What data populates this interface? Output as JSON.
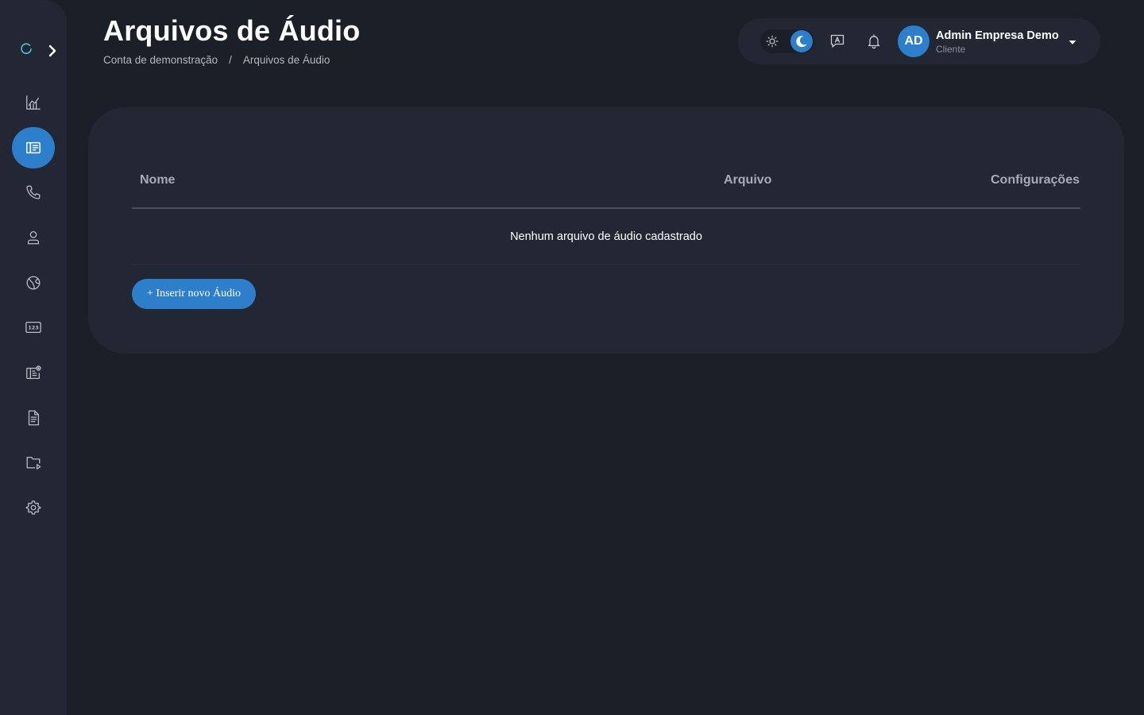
{
  "colors": {
    "background": "#1b1f27",
    "panel": "#222733",
    "accent": "#2e7fcb",
    "icon": "#b9bdc6",
    "muted_text": "#a6abb5"
  },
  "sidebar": {
    "logo_icon": "spinner-logo-icon",
    "expand_icon": "chevron-right-icon",
    "items": [
      {
        "icon": "chart-icon",
        "active": false
      },
      {
        "icon": "audio-library-icon",
        "active": true
      },
      {
        "icon": "phone-icon",
        "active": false
      },
      {
        "icon": "user-icon",
        "active": false
      },
      {
        "icon": "globe-icon",
        "active": false
      },
      {
        "icon": "numbers-icon",
        "active": false
      },
      {
        "icon": "library-settings-icon",
        "active": false
      },
      {
        "icon": "document-icon",
        "active": false
      },
      {
        "icon": "media-folder-icon",
        "active": false
      },
      {
        "icon": "gear-icon",
        "active": false
      }
    ]
  },
  "header": {
    "title": "Arquivos de Áudio",
    "breadcrumb": [
      "Conta de demonstração",
      "/",
      "Arquivos de Áudio"
    ]
  },
  "topbar": {
    "theme_light_icon": "sun-icon",
    "theme_dark_icon": "moon-icon",
    "active_theme": "dark",
    "chat_icon": "chat-icon",
    "notification_icon": "bell-icon",
    "avatar_initials": "AD",
    "user_name": "Admin Empresa Demo",
    "user_role": "Cliente"
  },
  "table": {
    "columns": [
      "Nome",
      "Arquivo",
      "Configurações"
    ],
    "rows": [],
    "empty_message": "Nenhum arquivo de áudio cadastrado"
  },
  "actions": {
    "add_label": "+ Inserir novo Áudio"
  }
}
